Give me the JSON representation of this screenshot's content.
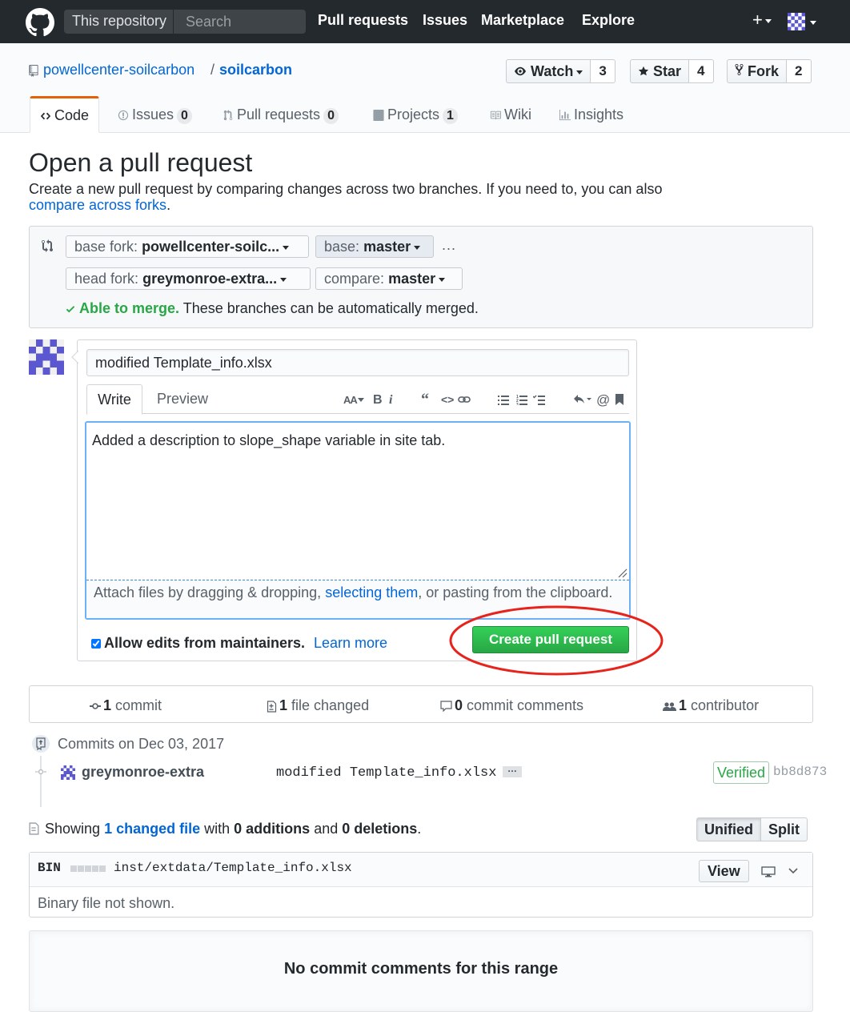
{
  "header": {
    "scope_label": "This repository",
    "search_placeholder": "Search",
    "nav": [
      "Pull requests",
      "Issues",
      "Marketplace",
      "Explore"
    ],
    "plus": "+"
  },
  "repo": {
    "owner": "powellcenter-soilcarbon",
    "separator": "/",
    "name": "soilcarbon",
    "watch": {
      "label": "Watch",
      "count": "3"
    },
    "star": {
      "label": "Star",
      "count": "4"
    },
    "fork": {
      "label": "Fork",
      "count": "2"
    }
  },
  "tabs": [
    {
      "label": "Code",
      "counter": "",
      "icon": "code-icon"
    },
    {
      "label": "Issues",
      "counter": "0",
      "icon": "issue-icon"
    },
    {
      "label": "Pull requests",
      "counter": "0",
      "icon": "pull-request-icon"
    },
    {
      "label": "Projects",
      "counter": "1",
      "icon": "project-icon"
    },
    {
      "label": "Wiki",
      "counter": "",
      "icon": "book-icon"
    },
    {
      "label": "Insights",
      "counter": "",
      "icon": "graph-icon"
    }
  ],
  "compare": {
    "title": "Open a pull request",
    "description": "Create a new pull request by comparing changes across two branches. If you need to, you can also",
    "forks_link": "compare across forks",
    "forks_period": ".",
    "base_fork": {
      "label": "base fork:",
      "value": "powellcenter-soilc..."
    },
    "base": {
      "label": "base:",
      "value": "master"
    },
    "head_fork": {
      "label": "head fork:",
      "value": "greymonroe-extra..."
    },
    "compare": {
      "label": "compare:",
      "value": "master"
    },
    "dots": "...",
    "merge_ok": "Able to merge.",
    "merge_note": "These branches can be automatically merged."
  },
  "form": {
    "title_value": "modified Template_info.xlsx",
    "write_tab": "Write",
    "preview_tab": "Preview",
    "toolbar": {
      "header": "AA",
      "bold": "B",
      "italic": "i",
      "quote": "66",
      "code": "<>",
      "mention": "@"
    },
    "body_value": "Added a description to slope_shape variable in site tab.",
    "drag_before": "Attach files by dragging & dropping, ",
    "drag_link": "selecting them",
    "drag_after": ", or pasting from the clipboard.",
    "maintainers_label": "Allow edits from maintainers.",
    "learn_more": "Learn more",
    "submit": "Create pull request",
    "highlight_color": "#e8231c"
  },
  "numbers": {
    "commits": {
      "count": "1",
      "label": "commit"
    },
    "files": {
      "count": "1",
      "label": "file changed"
    },
    "comments": {
      "count": "0",
      "label": "commit comments"
    },
    "contributors": {
      "count": "1",
      "label": "contributor"
    }
  },
  "commits": {
    "date_heading": "Commits on Dec 03, 2017",
    "items": [
      {
        "author": "greymonroe-extra",
        "message": "modified Template_info.xlsx",
        "more": "…",
        "verified": "Verified",
        "sha": "bb8d873"
      }
    ]
  },
  "diff": {
    "showing": "Showing",
    "changed_link": "1 changed file",
    "with": "with",
    "additions": "0 additions",
    "and": "and",
    "deletions": "0 deletions",
    "period": ".",
    "unified": "Unified",
    "split": "Split",
    "file": {
      "type": "BIN",
      "path": "inst/extdata/Template_info.xlsx",
      "view": "View",
      "note": "Binary file not shown."
    }
  },
  "blankslate": "No commit comments for this range",
  "colors": {
    "header_bg": "#24292e",
    "link": "#0366d6",
    "success": "#28a745",
    "tab_accent": "#e36209"
  }
}
